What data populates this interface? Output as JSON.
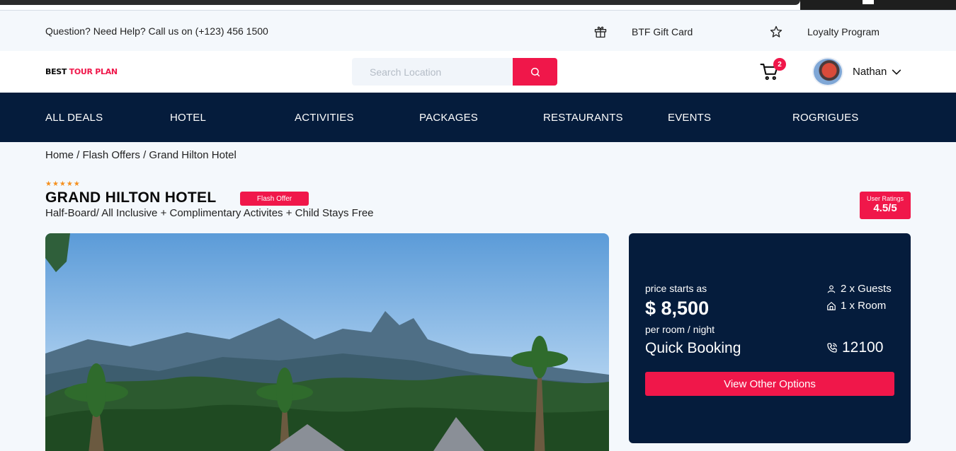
{
  "topbar": {
    "help_text": "Question? Need Help? Call us on (+123) 456 1500",
    "gift_card": "BTF Gift Card",
    "loyalty": "Loyalty Program"
  },
  "header": {
    "logo_part1": "BEST",
    "logo_part2": "TOUR PLAN",
    "search_placeholder": "Search Location",
    "cart_count": "2",
    "user_name": "Nathan"
  },
  "nav": {
    "items": [
      "ALL DEALS",
      "HOTEL",
      "ACTIVITIES",
      "PACKAGES",
      "RESTAURANTS",
      "EVENTS",
      "ROGRIGUES"
    ]
  },
  "breadcrumb": "Home / Flash Offers / Grand Hilton Hotel",
  "hotel": {
    "stars": "★★★★★",
    "name": "GRAND HILTON HOTEL",
    "badge": "Flash Offer",
    "subtitle": "Half-Board/ All Inclusive + Complimentary Activites + Child Stays Free",
    "rating_label": "User Ratings",
    "rating_value": "4.5/5"
  },
  "booking": {
    "price_label": "price starts as",
    "price": "$ 8,500",
    "price_unit": "per room / night",
    "quick_booking": "Quick Booking",
    "guests": "2 x Guests",
    "rooms": "1 x Room",
    "phone": "12100",
    "options_button": "View Other Options"
  },
  "colors": {
    "accent": "#f0174a",
    "navy": "#051c3c",
    "star": "#f5901e"
  }
}
